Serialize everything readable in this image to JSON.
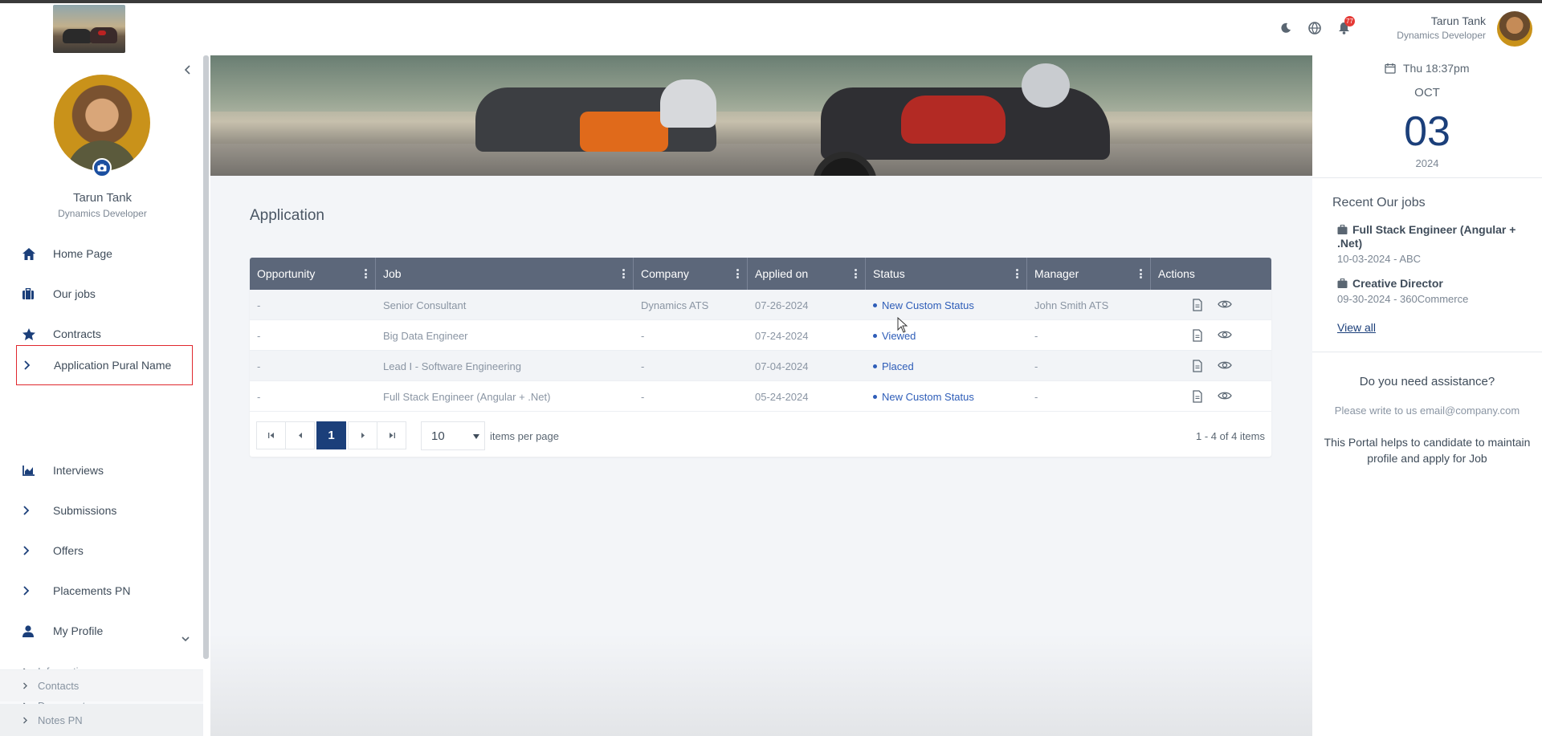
{
  "header": {
    "user_name": "Tarun Tank",
    "user_role": "Dynamics Developer",
    "notification_count": "77",
    "icons": [
      "moon-icon",
      "globe-icon",
      "bell-icon"
    ]
  },
  "sidebar": {
    "user_name": "Tarun Tank",
    "user_role": "Dynamics Developer",
    "nav": [
      {
        "label": "Home Page",
        "icon": "home-icon"
      },
      {
        "label": "Our jobs",
        "icon": "briefcase-icon"
      },
      {
        "label": "Contracts",
        "icon": "star-icon"
      },
      {
        "label": "Application Pural Name",
        "icon": "chevron-right-icon"
      },
      {
        "label": "Interviews",
        "icon": "chart-icon"
      },
      {
        "label": "Submissions",
        "icon": "chevron-right-icon"
      },
      {
        "label": "Offers",
        "icon": "chevron-right-icon"
      },
      {
        "label": "Placements PN",
        "icon": "chevron-right-icon"
      },
      {
        "label": "My Profile",
        "icon": "user-icon"
      }
    ],
    "profile_sub": [
      {
        "label": "Information"
      },
      {
        "label": "Documents"
      },
      {
        "label": "Contacts"
      },
      {
        "label": "Notes PN"
      }
    ]
  },
  "main": {
    "title": "Application",
    "columns": [
      "Opportunity",
      "Job",
      "Company",
      "Applied on",
      "Status",
      "Manager",
      "Actions"
    ],
    "rows": [
      {
        "opportunity": "-",
        "job": "Senior Consultant",
        "company": "Dynamics ATS",
        "applied": "07-26-2024",
        "status": "New Custom Status",
        "manager": "John Smith ATS"
      },
      {
        "opportunity": "-",
        "job": "Big Data Engineer",
        "company": "-",
        "applied": "07-24-2024",
        "status": "Viewed",
        "manager": "-"
      },
      {
        "opportunity": "-",
        "job": "Lead I - Software Engineering",
        "company": "-",
        "applied": "07-04-2024",
        "status": "Placed",
        "manager": "-"
      },
      {
        "opportunity": "-",
        "job": "Full Stack Engineer (Angular + .Net)",
        "company": "-",
        "applied": "05-24-2024",
        "status": "New Custom Status",
        "manager": "-"
      }
    ],
    "pager": {
      "current_page": "1",
      "page_size": "10",
      "items_per_page_label": "items per page",
      "info": "1 - 4 of 4 items"
    }
  },
  "right_panel": {
    "datetime": "Thu 18:37pm",
    "month": "OCT",
    "day": "03",
    "year": "2024",
    "recent_title": "Recent Our jobs",
    "recent_jobs": [
      {
        "title": "Full Stack Engineer (Angular + .Net)",
        "meta": "10-03-2024 - ABC"
      },
      {
        "title": "Creative Director",
        "meta": "09-30-2024 - 360Commerce"
      }
    ],
    "view_all": "View all",
    "help_title": "Do you need assistance?",
    "help_email": "Please write to us email@company.com",
    "help_desc": "This Portal helps to candidate to maintain profile and apply for Job"
  },
  "colors": {
    "accent": "#1b3f7a",
    "grid_header": "#5c677a",
    "status_link": "#2e5db8",
    "highlight_border": "#e0282e"
  }
}
